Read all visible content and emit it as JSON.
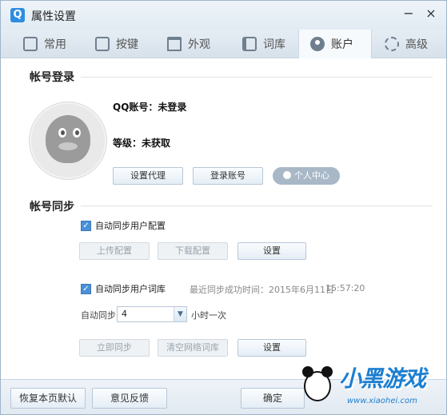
{
  "window": {
    "title": "属性设置",
    "app_icon": "Q",
    "minimize": "−",
    "close": "×"
  },
  "tabs": [
    {
      "label": "常用",
      "icon": "monitor-icon"
    },
    {
      "label": "按键",
      "icon": "key-icon"
    },
    {
      "label": "外观",
      "icon": "shirt-icon"
    },
    {
      "label": "词库",
      "icon": "book-icon"
    },
    {
      "label": "账户",
      "icon": "user-icon",
      "active": true
    },
    {
      "label": "高级",
      "icon": "gear-icon"
    }
  ],
  "login": {
    "section_title": "帐号登录",
    "qq_account": "QQ账号：未登录",
    "level": "等级：未获取",
    "proxy_button": "设置代理",
    "login_button": "登录账号",
    "personal_center_button": "个人中心"
  },
  "sync": {
    "section_title": "帐号同步",
    "config_checkbox": "自动同步用户配置",
    "config_checked": true,
    "upload_button": "上传配置",
    "download_button": "下载配置",
    "config_settings_button": "设置",
    "dict_checkbox": "自动同步用户词库",
    "dict_checked": true,
    "last_sync_label": "最近同步成功时间：2015年6月11日",
    "last_sync_time": "15:57:20",
    "auto_sync_label": "自动同步",
    "interval_value": "4",
    "interval_unit": "小时一次",
    "sync_now_button": "立即同步",
    "clear_cloud_button": "清空网络词库",
    "dict_settings_button": "设置"
  },
  "footer": {
    "restore_button": "恢复本页默认",
    "feedback_button": "意见反馈",
    "ok_button": "确定"
  },
  "watermark": {
    "text": "小黑游戏",
    "url": "www.xiaohei.com"
  },
  "colors": {
    "accent": "#4a90d9",
    "brand": "#2e8de0"
  }
}
